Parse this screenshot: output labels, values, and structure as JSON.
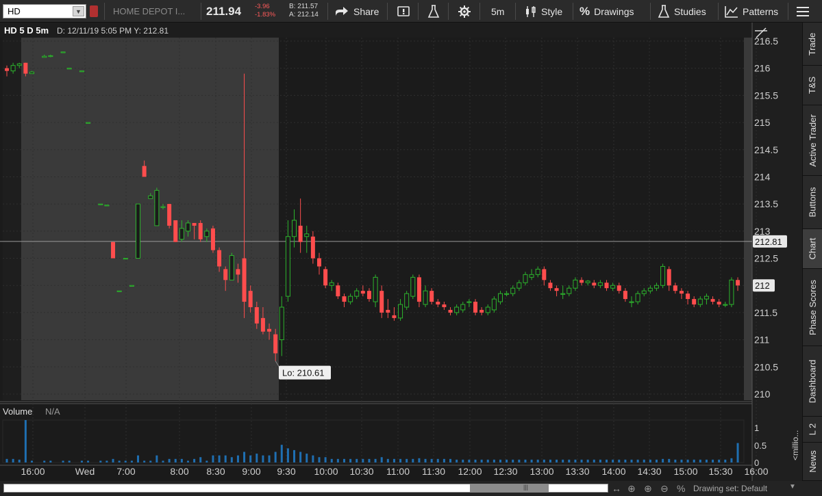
{
  "toolbar": {
    "symbol": "HD",
    "company": "HOME DEPOT I...",
    "last": "211.94",
    "change": "-3.96",
    "change_pct": "-1.83%",
    "bid": "B: 211.57",
    "ask": "A: 212.14",
    "share": "Share",
    "interval": "5m",
    "style": "Style",
    "drawings": "Drawings",
    "studies": "Studies",
    "patterns": "Patterns"
  },
  "chart": {
    "title": "HD 5 D 5m",
    "info": "D: 12/11/19 5:05 PM  Y: 212.81",
    "crosshair_value": "212.81",
    "last_value": "212",
    "lo_label": "Lo: 210.61",
    "price_ticks": [
      "216.5",
      "216",
      "215.5",
      "215",
      "214.5",
      "214",
      "213.5",
      "213",
      "212.5",
      "212",
      "211.5",
      "211",
      "210.5",
      "210"
    ],
    "time_ticks": [
      "16:00",
      "Wed",
      "7:00",
      "8:00",
      "8:30",
      "9:00",
      "9:30",
      "10:00",
      "10:30",
      "11:00",
      "11:30",
      "12:00",
      "12:30",
      "13:00",
      "13:30",
      "14:00",
      "14:30",
      "15:00",
      "15:30",
      "16:00"
    ],
    "volume_label": "Volume",
    "volume_na": "N/A",
    "volume_ticks": [
      "1",
      "0.5",
      "0"
    ],
    "volume_units": "<millio..."
  },
  "chart_data": {
    "type": "candlestick",
    "ylim": [
      210,
      216.5
    ],
    "colors": {
      "up": "#2db52d",
      "down": "#ff4d4d",
      "volume": "#1f6fb2",
      "grid": "#2f2f2f",
      "premarket": "#3a3a3a"
    },
    "candles": [
      [
        0,
        216,
        216.05,
        215.85,
        215.95,
        0.1
      ],
      [
        1,
        215.95,
        216.1,
        215.9,
        216.05,
        0.1
      ],
      [
        2,
        216.05,
        216.1,
        216,
        216.08,
        0.08
      ],
      [
        3,
        216.1,
        216.1,
        215.85,
        215.9,
        1.2
      ],
      [
        4,
        215.9,
        215.95,
        215.9,
        215.93,
        0.05
      ],
      [
        6,
        216.2,
        216.25,
        216.2,
        216.22,
        0.05
      ],
      [
        7,
        216.22,
        216.25,
        216.2,
        216.23,
        0.05
      ],
      [
        9,
        216.3,
        216.3,
        216.3,
        216.3,
        0.05
      ],
      [
        10,
        216.0,
        216.0,
        216.0,
        216.0,
        0.05
      ],
      [
        12,
        215.95,
        215.95,
        215.95,
        215.95,
        0.05
      ],
      [
        13,
        215.0,
        215.0,
        214.98,
        215.0,
        0.05
      ],
      [
        15,
        213.5,
        213.5,
        213.48,
        213.5,
        0.05
      ],
      [
        16,
        213.48,
        213.48,
        213.48,
        213.48,
        0.05
      ],
      [
        17,
        212.8,
        212.8,
        212.5,
        212.5,
        0.1
      ],
      [
        18,
        211.9,
        211.9,
        211.88,
        211.9,
        0.05
      ],
      [
        19,
        212.5,
        212.5,
        212.48,
        212.5,
        0.05
      ],
      [
        20,
        212.0,
        212.0,
        212.0,
        212.0,
        0.05
      ],
      [
        21,
        212.5,
        213.5,
        212.5,
        213.5,
        0.2
      ],
      [
        22,
        214.2,
        214.3,
        214.0,
        214.0,
        0.05
      ],
      [
        23,
        213.6,
        213.7,
        213.6,
        213.65,
        0.05
      ],
      [
        24,
        213.1,
        213.8,
        213.1,
        213.75,
        0.2
      ],
      [
        25,
        213.45,
        213.5,
        213.4,
        213.45,
        0.05
      ],
      [
        26,
        213.5,
        213.5,
        213.05,
        213.1,
        0.1
      ],
      [
        27,
        213.2,
        213.2,
        212.8,
        212.8,
        0.1
      ],
      [
        28,
        212.85,
        213.2,
        212.8,
        213.05,
        0.1
      ],
      [
        29,
        213.0,
        213.2,
        212.9,
        213.15,
        0.05
      ],
      [
        30,
        213.15,
        213.15,
        212.85,
        213.1,
        0.1
      ],
      [
        31,
        213.15,
        213.2,
        212.8,
        212.85,
        0.15
      ],
      [
        32,
        212.9,
        213.05,
        212.8,
        213.0,
        0.05
      ],
      [
        33,
        213.05,
        213.1,
        212.6,
        212.65,
        0.2
      ],
      [
        34,
        212.65,
        212.7,
        212.25,
        212.35,
        0.2
      ],
      [
        35,
        212.3,
        212.35,
        211.9,
        212.1,
        0.2
      ],
      [
        36,
        212.1,
        212.6,
        212.1,
        212.55,
        0.15
      ],
      [
        37,
        212.3,
        212.4,
        212.05,
        212.2,
        0.2
      ],
      [
        38,
        212.5,
        215.9,
        211.4,
        211.7,
        0.3
      ],
      [
        39,
        211.9,
        212.0,
        211.5,
        211.6,
        0.2
      ],
      [
        40,
        211.6,
        211.7,
        211.2,
        211.3,
        0.25
      ],
      [
        41,
        211.4,
        211.6,
        211.1,
        211.15,
        0.2
      ],
      [
        42,
        211.2,
        211.3,
        211.0,
        211.15,
        0.2
      ],
      [
        43,
        211.1,
        211.2,
        210.61,
        210.75,
        0.3
      ],
      [
        44,
        211.0,
        211.8,
        210.7,
        211.6,
        0.5
      ],
      [
        45,
        211.8,
        213.2,
        211.7,
        212.9,
        0.4
      ],
      [
        46,
        212.9,
        213.4,
        212.7,
        213.2,
        0.35
      ],
      [
        47,
        213.1,
        213.6,
        212.6,
        212.8,
        0.3
      ],
      [
        48,
        212.9,
        213.1,
        212.6,
        212.95,
        0.25
      ],
      [
        49,
        212.9,
        213.0,
        212.4,
        212.5,
        0.2
      ],
      [
        50,
        212.5,
        212.6,
        212.2,
        212.35,
        0.15
      ],
      [
        51,
        212.3,
        212.35,
        211.95,
        212.0,
        0.15
      ],
      [
        52,
        212.0,
        212.1,
        211.9,
        212.05,
        0.1
      ],
      [
        53,
        212.0,
        212.05,
        211.75,
        211.8,
        0.1
      ],
      [
        54,
        211.8,
        211.85,
        211.6,
        211.7,
        0.1
      ],
      [
        55,
        211.7,
        211.85,
        211.65,
        211.8,
        0.1
      ],
      [
        56,
        211.8,
        211.95,
        211.75,
        211.9,
        0.1
      ],
      [
        57,
        211.9,
        212.0,
        211.8,
        211.85,
        0.1
      ],
      [
        58,
        211.9,
        211.95,
        211.7,
        211.75,
        0.1
      ],
      [
        59,
        211.7,
        212.2,
        211.6,
        212.15,
        0.1
      ],
      [
        60,
        211.9,
        212.0,
        211.4,
        211.5,
        0.15
      ],
      [
        61,
        211.55,
        211.75,
        211.4,
        211.5,
        0.1
      ],
      [
        62,
        211.45,
        211.6,
        211.35,
        211.4,
        0.1
      ],
      [
        63,
        211.4,
        211.75,
        211.35,
        211.65,
        0.1
      ],
      [
        64,
        211.6,
        211.9,
        211.55,
        211.85,
        0.1
      ],
      [
        65,
        211.8,
        212.2,
        211.75,
        212.15,
        0.1
      ],
      [
        66,
        212.15,
        212.2,
        211.6,
        211.7,
        0.12
      ],
      [
        67,
        211.65,
        212.0,
        211.6,
        211.9,
        0.1
      ],
      [
        68,
        211.9,
        211.95,
        211.65,
        211.7,
        0.1
      ],
      [
        69,
        211.7,
        211.75,
        211.6,
        211.65,
        0.1
      ],
      [
        70,
        211.65,
        211.7,
        211.55,
        211.6,
        0.1
      ],
      [
        71,
        211.55,
        211.6,
        211.45,
        211.5,
        0.1
      ],
      [
        72,
        211.5,
        211.65,
        211.45,
        211.6,
        0.08
      ],
      [
        73,
        211.55,
        211.7,
        211.5,
        211.65,
        0.08
      ],
      [
        74,
        211.7,
        211.75,
        211.6,
        211.7,
        0.08
      ],
      [
        75,
        211.7,
        211.75,
        211.45,
        211.5,
        0.08
      ],
      [
        76,
        211.55,
        211.6,
        211.45,
        211.5,
        0.08
      ],
      [
        77,
        211.5,
        211.65,
        211.45,
        211.6,
        0.08
      ],
      [
        78,
        211.55,
        211.8,
        211.5,
        211.75,
        0.08
      ],
      [
        79,
        211.7,
        211.9,
        211.65,
        211.85,
        0.08
      ],
      [
        80,
        211.85,
        211.9,
        211.8,
        211.85,
        0.08
      ],
      [
        81,
        211.85,
        212.0,
        211.8,
        211.95,
        0.08
      ],
      [
        82,
        211.95,
        212.1,
        211.9,
        212.05,
        0.08
      ],
      [
        83,
        212.05,
        212.25,
        212.0,
        212.2,
        0.08
      ],
      [
        84,
        212.15,
        212.3,
        212.1,
        212.2,
        0.08
      ],
      [
        85,
        212.2,
        212.35,
        212.15,
        212.3,
        0.08
      ],
      [
        86,
        212.3,
        212.35,
        212.0,
        212.1,
        0.08
      ],
      [
        87,
        212.05,
        212.1,
        211.9,
        211.95,
        0.08
      ],
      [
        88,
        211.95,
        212.0,
        211.8,
        211.9,
        0.08
      ],
      [
        89,
        211.85,
        212.0,
        211.75,
        211.85,
        0.08
      ],
      [
        90,
        211.85,
        212.0,
        211.8,
        211.95,
        0.08
      ],
      [
        91,
        211.95,
        212.15,
        211.9,
        212.1,
        0.08
      ],
      [
        92,
        212.1,
        212.15,
        212.0,
        212.05,
        0.08
      ],
      [
        93,
        212.05,
        212.1,
        212.0,
        212.08,
        0.08
      ],
      [
        94,
        212.05,
        212.1,
        211.95,
        212.0,
        0.08
      ],
      [
        95,
        212.0,
        212.1,
        211.95,
        212.05,
        0.08
      ],
      [
        96,
        212.05,
        212.1,
        211.9,
        211.95,
        0.08
      ],
      [
        97,
        211.95,
        212.05,
        211.9,
        212.0,
        0.08
      ],
      [
        98,
        212.0,
        212.05,
        211.85,
        211.9,
        0.08
      ],
      [
        99,
        211.9,
        211.95,
        211.7,
        211.75,
        0.08
      ],
      [
        100,
        211.7,
        211.8,
        211.6,
        211.7,
        0.08
      ],
      [
        101,
        211.7,
        211.9,
        211.65,
        211.85,
        0.08
      ],
      [
        102,
        211.85,
        211.95,
        211.8,
        211.9,
        0.08
      ],
      [
        103,
        211.9,
        212.0,
        211.85,
        211.95,
        0.08
      ],
      [
        104,
        211.95,
        212.05,
        211.9,
        212.0,
        0.08
      ],
      [
        105,
        212.0,
        212.4,
        211.95,
        212.35,
        0.1
      ],
      [
        106,
        212.3,
        212.35,
        211.9,
        212.0,
        0.1
      ],
      [
        107,
        212.0,
        212.05,
        211.85,
        211.9,
        0.08
      ],
      [
        108,
        211.9,
        211.95,
        211.75,
        211.85,
        0.08
      ],
      [
        109,
        211.85,
        211.9,
        211.65,
        211.75,
        0.08
      ],
      [
        110,
        211.75,
        211.8,
        211.6,
        211.65,
        0.08
      ],
      [
        111,
        211.65,
        211.8,
        211.6,
        211.75,
        0.08
      ],
      [
        112,
        211.75,
        211.85,
        211.65,
        211.8,
        0.08
      ],
      [
        113,
        211.75,
        211.8,
        211.65,
        211.7,
        0.08
      ],
      [
        114,
        211.7,
        211.75,
        211.6,
        211.65,
        0.08
      ],
      [
        115,
        211.65,
        211.7,
        211.6,
        211.65,
        0.08
      ],
      [
        116,
        211.65,
        212.15,
        211.6,
        212.1,
        0.12
      ],
      [
        117,
        212.1,
        212.15,
        211.9,
        212.0,
        0.55
      ]
    ]
  },
  "right_tabs": [
    "Trade",
    "T&S",
    "Active Trader",
    "Buttons",
    "Chart",
    "Phase Scores",
    "Dashboard",
    "L 2",
    "News"
  ],
  "bottom": {
    "drawing_set": "Drawing set: Default"
  }
}
